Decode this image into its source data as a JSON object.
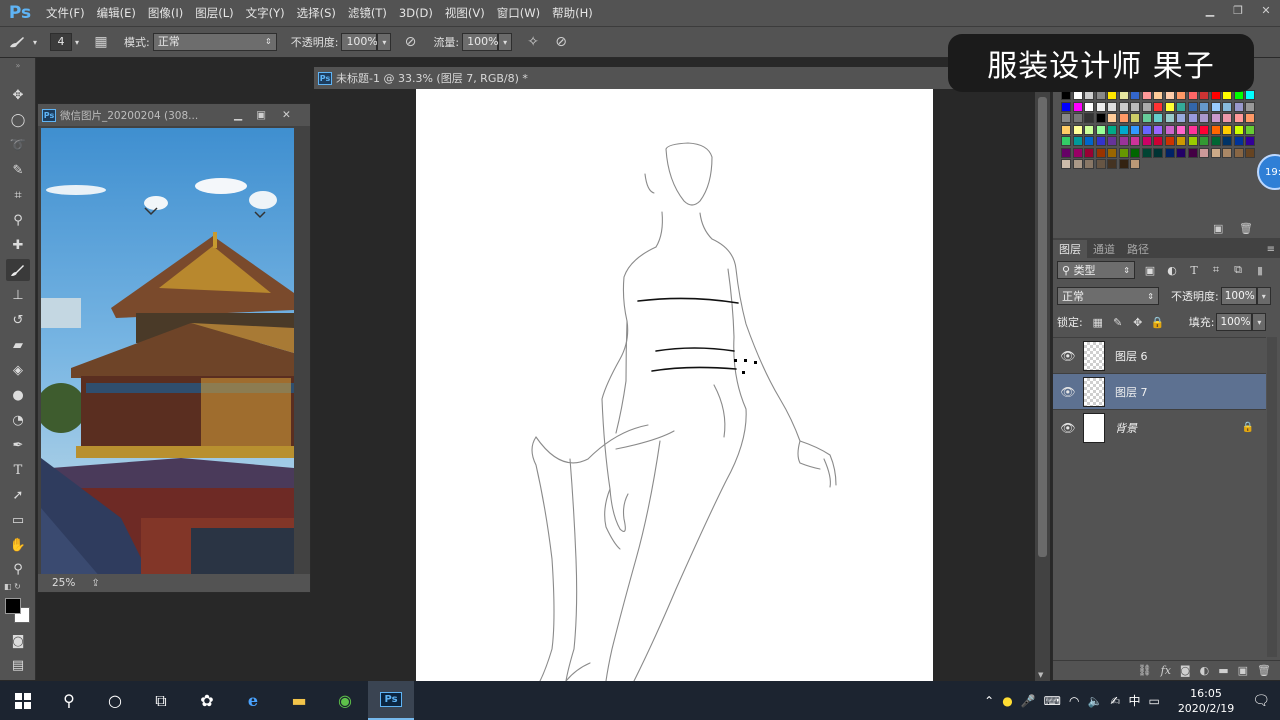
{
  "app": {
    "logo": "Ps",
    "menu": [
      "文件(F)",
      "编辑(E)",
      "图像(I)",
      "图层(L)",
      "文字(Y)",
      "选择(S)",
      "滤镜(T)",
      "3D(D)",
      "视图(V)",
      "窗口(W)",
      "帮助(H)"
    ]
  },
  "options": {
    "brush_size": "4",
    "mode_label": "模式:",
    "mode_value": "正常",
    "opacity_label": "不透明度:",
    "opacity_value": "100%",
    "flow_label": "流量:",
    "flow_value": "100%"
  },
  "watermark": "服装设计师 果子",
  "photo_window": {
    "title": "微信图片_20200204 (308...",
    "zoom": "25%"
  },
  "document": {
    "title": "未标题-1 @ 33.3% (图层 7, RGB/8) *"
  },
  "panels": {
    "tabs": [
      "图层",
      "通道",
      "路径"
    ],
    "filter_kind": "类型",
    "blend_mode": "正常",
    "opacity_label": "不透明度:",
    "opacity_value": "100%",
    "lock_label": "锁定:",
    "fill_label": "填充:",
    "fill_value": "100%",
    "layers": [
      {
        "name": "图层 6",
        "selected": false,
        "type": "transparent"
      },
      {
        "name": "图层 7",
        "selected": true,
        "type": "transparent"
      },
      {
        "name": "背景",
        "selected": false,
        "type": "white",
        "locked": true
      }
    ],
    "swatch_colors": [
      "#000000",
      "#ffffff",
      "#cccccc",
      "#888888",
      "#ffe600",
      "#e6e6a0",
      "#3366cc",
      "#ff9999",
      "#ffcc99",
      "#ffccaa",
      "#ff9966",
      "#ff6666",
      "#cc3333",
      "#ff0000",
      "#ffff00",
      "#00ff00",
      "#00ffff",
      "#0000ff",
      "#ff00ff",
      "#ffffff",
      "#eeeeee",
      "#dddddd",
      "#cccccc",
      "#bbbbbb",
      "#aaaaaa",
      "#ff3333",
      "#ffff33",
      "#33aa99",
      "#3366aa",
      "#6699cc",
      "#99ccff",
      "#88bbdd",
      "#9999cc",
      "#999999",
      "#888888",
      "#777777",
      "#333333",
      "#000000",
      "#ffcc99",
      "#ff9966",
      "#cccc66",
      "#66cc99",
      "#66cccc",
      "#99cccc",
      "#99aadd",
      "#9999dd",
      "#aa99cc",
      "#cc99cc",
      "#ee99aa",
      "#ff9999",
      "#ff9966",
      "#ffcc66",
      "#ffff99",
      "#ccff99",
      "#99ff99",
      "#00aa88",
      "#00aacc",
      "#3399ff",
      "#6666ff",
      "#9966ff",
      "#cc66cc",
      "#ff66cc",
      "#ff3399",
      "#ff0033",
      "#ff6600",
      "#ffcc00",
      "#ccff00",
      "#66cc33",
      "#33cc66",
      "#009999",
      "#0066cc",
      "#3333cc",
      "#663399",
      "#993399",
      "#cc3399",
      "#cc0066",
      "#cc0033",
      "#cc3300",
      "#cc9900",
      "#99cc00",
      "#339933",
      "#006633",
      "#003366",
      "#003399",
      "#330099",
      "#660066",
      "#990066",
      "#990033",
      "#993300",
      "#996600",
      "#669900",
      "#006600",
      "#004433",
      "#003333",
      "#002266",
      "#220066",
      "#440044",
      "#cc9999",
      "#ccaa88",
      "#aa8866",
      "#886644",
      "#664422",
      "#ccbbaa",
      "#aa9988",
      "#887766",
      "#665544",
      "#443322",
      "#332211",
      "#bb9977"
    ],
    "timer_text": "19:"
  },
  "taskbar": {
    "time": "16:05",
    "date": "2020/2/19",
    "ime": "中"
  }
}
